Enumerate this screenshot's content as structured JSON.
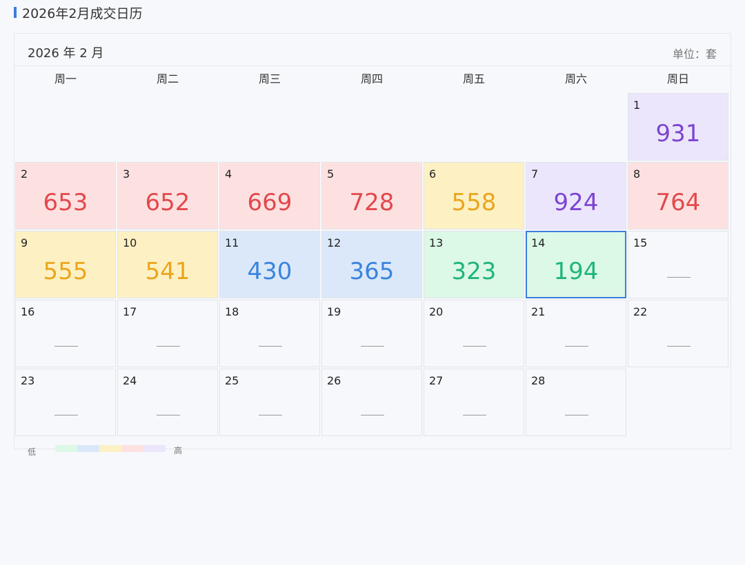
{
  "page_title": "2026年2月成交日历",
  "calendar": {
    "month_label": "2026 年 2 月",
    "unit_label": "单位：套",
    "weekdays": [
      "周一",
      "周二",
      "周三",
      "周四",
      "周五",
      "周六",
      "周日"
    ],
    "empty_placeholder": "—",
    "selected_day": 14,
    "days": [
      {
        "day": "1",
        "weekday": "周日",
        "value": "931",
        "level": "purple"
      },
      {
        "day": "2",
        "weekday": "周一",
        "value": "653",
        "level": "red"
      },
      {
        "day": "3",
        "weekday": "周二",
        "value": "652",
        "level": "red"
      },
      {
        "day": "4",
        "weekday": "周三",
        "value": "669",
        "level": "red"
      },
      {
        "day": "5",
        "weekday": "周四",
        "value": "728",
        "level": "red"
      },
      {
        "day": "6",
        "weekday": "周五",
        "value": "558",
        "level": "yellow"
      },
      {
        "day": "7",
        "weekday": "周六",
        "value": "924",
        "level": "purple"
      },
      {
        "day": "8",
        "weekday": "周日",
        "value": "764",
        "level": "red"
      },
      {
        "day": "9",
        "weekday": "周一",
        "value": "555",
        "level": "yellow"
      },
      {
        "day": "10",
        "weekday": "周二",
        "value": "541",
        "level": "yellow"
      },
      {
        "day": "11",
        "weekday": "周三",
        "value": "430",
        "level": "blue"
      },
      {
        "day": "12",
        "weekday": "周四",
        "value": "365",
        "level": "blue"
      },
      {
        "day": "13",
        "weekday": "周五",
        "value": "323",
        "level": "green"
      },
      {
        "day": "14",
        "weekday": "周六",
        "value": "194",
        "level": "green"
      },
      {
        "day": "15",
        "weekday": "周日",
        "value": null,
        "level": "none"
      },
      {
        "day": "16",
        "weekday": "周一",
        "value": null,
        "level": "none"
      },
      {
        "day": "17",
        "weekday": "周二",
        "value": null,
        "level": "none"
      },
      {
        "day": "18",
        "weekday": "周三",
        "value": null,
        "level": "none"
      },
      {
        "day": "19",
        "weekday": "周四",
        "value": null,
        "level": "none"
      },
      {
        "day": "20",
        "weekday": "周五",
        "value": null,
        "level": "none"
      },
      {
        "day": "21",
        "weekday": "周六",
        "value": null,
        "level": "none"
      },
      {
        "day": "22",
        "weekday": "周日",
        "value": null,
        "level": "none"
      },
      {
        "day": "23",
        "weekday": "周一",
        "value": null,
        "level": "none"
      },
      {
        "day": "24",
        "weekday": "周二",
        "value": null,
        "level": "none"
      },
      {
        "day": "25",
        "weekday": "周三",
        "value": null,
        "level": "none"
      },
      {
        "day": "26",
        "weekday": "周四",
        "value": null,
        "level": "none"
      },
      {
        "day": "27",
        "weekday": "周五",
        "value": null,
        "level": "none"
      },
      {
        "day": "28",
        "weekday": "周六",
        "value": null,
        "level": "none"
      }
    ]
  },
  "legend": {
    "low_label": "低",
    "high_label": "高",
    "levels": [
      "green",
      "blue",
      "yellow",
      "red",
      "purple"
    ]
  },
  "colors": {
    "accent": "#3b7de0",
    "green": {
      "bg": "#dcf8e6",
      "text": "#1fb579"
    },
    "blue": {
      "bg": "#dbe8fa",
      "text": "#3a84dc"
    },
    "yellow": {
      "bg": "#fdf1c4",
      "text": "#eba51c"
    },
    "red": {
      "bg": "#fde1e1",
      "text": "#e2484c"
    },
    "purple": {
      "bg": "#ebe6fc",
      "text": "#7d44d2"
    }
  }
}
